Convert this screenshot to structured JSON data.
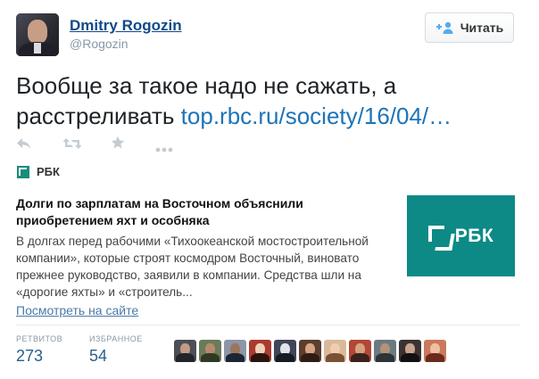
{
  "author": {
    "name": "Dmitry Rogozin",
    "handle": "@Rogozin"
  },
  "follow_button": {
    "label": "Читать"
  },
  "tweet": {
    "text": "Вообще за такое надо не сажать, а расстреливать ",
    "link": "top.rbc.ru/society/16/04/…"
  },
  "actions": [
    "reply-icon",
    "retweet-icon",
    "favorite-icon",
    "more-icon"
  ],
  "card": {
    "source": "РБК",
    "title": "Долги по зарплатам на Восточном объяснили приобретением яхт и особняка",
    "description": "В долгах перед рабочими «Тихоокеанской мостостроительной компании», которые строят космодром Восточный, виновато прежнее руководство, заявили в компании. Средства шли на «дорогие яхты» и «строитель...",
    "view_link": "Посмотреть на сайте",
    "thumbnail_text": "РБК",
    "thumbnail_color": "#0d8a86"
  },
  "stats": {
    "retweets_label": "РЕТВИТОВ",
    "retweets_value": "273",
    "favorites_label": "ИЗБРАННОЕ",
    "favorites_value": "54"
  },
  "favoriters": [
    {
      "bg": "#4d4f57",
      "skin": "#c39b86",
      "body": "#22252b"
    },
    {
      "bg": "#6a7b59",
      "skin": "#b78a70",
      "body": "#2e3a24"
    },
    {
      "bg": "#8d96a6",
      "skin": "#9a7660",
      "body": "#1c2533"
    },
    {
      "bg": "#aa3b2f",
      "skin": "#f0d2b8",
      "body": "#2a1410"
    },
    {
      "bg": "#3e4658",
      "skin": "#e0e3ea",
      "body": "#161a24"
    },
    {
      "bg": "#5a3e2f",
      "skin": "#d7a584",
      "body": "#301c14"
    },
    {
      "bg": "#d9b99a",
      "skin": "#f1cdb0",
      "body": "#7a5136"
    },
    {
      "bg": "#b24735",
      "skin": "#d8a082",
      "body": "#3a221a"
    },
    {
      "bg": "#6b7a80",
      "skin": "#b59179",
      "body": "#2d3336"
    },
    {
      "bg": "#3a3332",
      "skin": "#c9a58f",
      "body": "#121010"
    },
    {
      "bg": "#c97a5c",
      "skin": "#f0c0a0",
      "body": "#6b2b1c"
    }
  ],
  "colors": {
    "link": "#1d74b8",
    "muted": "#8899a6",
    "stat_value": "#2b5f8a"
  }
}
